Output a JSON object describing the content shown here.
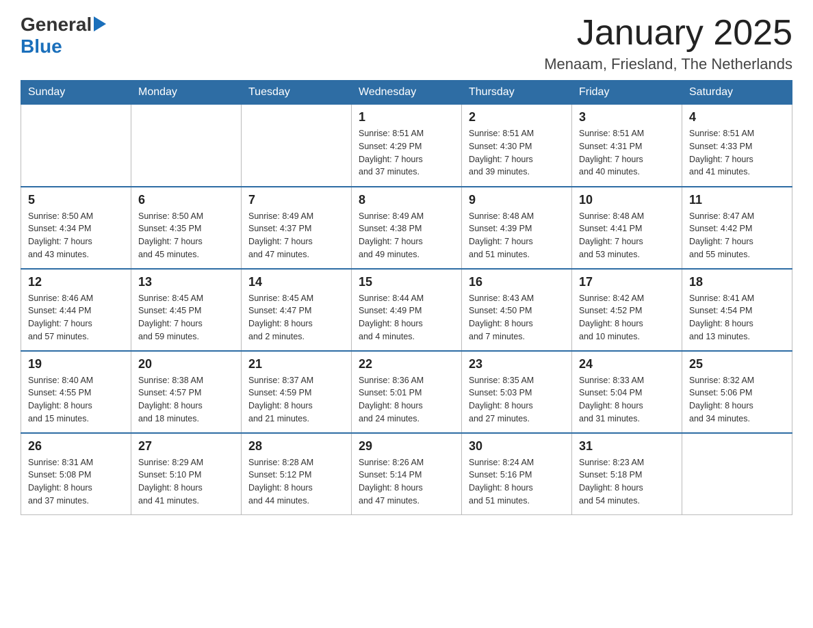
{
  "logo": {
    "text_general": "General",
    "text_blue": "Blue",
    "arrow": "▶"
  },
  "title": "January 2025",
  "subtitle": "Menaam, Friesland, The Netherlands",
  "headers": [
    "Sunday",
    "Monday",
    "Tuesday",
    "Wednesday",
    "Thursday",
    "Friday",
    "Saturday"
  ],
  "weeks": [
    [
      {
        "day": "",
        "info": ""
      },
      {
        "day": "",
        "info": ""
      },
      {
        "day": "",
        "info": ""
      },
      {
        "day": "1",
        "info": "Sunrise: 8:51 AM\nSunset: 4:29 PM\nDaylight: 7 hours\nand 37 minutes."
      },
      {
        "day": "2",
        "info": "Sunrise: 8:51 AM\nSunset: 4:30 PM\nDaylight: 7 hours\nand 39 minutes."
      },
      {
        "day": "3",
        "info": "Sunrise: 8:51 AM\nSunset: 4:31 PM\nDaylight: 7 hours\nand 40 minutes."
      },
      {
        "day": "4",
        "info": "Sunrise: 8:51 AM\nSunset: 4:33 PM\nDaylight: 7 hours\nand 41 minutes."
      }
    ],
    [
      {
        "day": "5",
        "info": "Sunrise: 8:50 AM\nSunset: 4:34 PM\nDaylight: 7 hours\nand 43 minutes."
      },
      {
        "day": "6",
        "info": "Sunrise: 8:50 AM\nSunset: 4:35 PM\nDaylight: 7 hours\nand 45 minutes."
      },
      {
        "day": "7",
        "info": "Sunrise: 8:49 AM\nSunset: 4:37 PM\nDaylight: 7 hours\nand 47 minutes."
      },
      {
        "day": "8",
        "info": "Sunrise: 8:49 AM\nSunset: 4:38 PM\nDaylight: 7 hours\nand 49 minutes."
      },
      {
        "day": "9",
        "info": "Sunrise: 8:48 AM\nSunset: 4:39 PM\nDaylight: 7 hours\nand 51 minutes."
      },
      {
        "day": "10",
        "info": "Sunrise: 8:48 AM\nSunset: 4:41 PM\nDaylight: 7 hours\nand 53 minutes."
      },
      {
        "day": "11",
        "info": "Sunrise: 8:47 AM\nSunset: 4:42 PM\nDaylight: 7 hours\nand 55 minutes."
      }
    ],
    [
      {
        "day": "12",
        "info": "Sunrise: 8:46 AM\nSunset: 4:44 PM\nDaylight: 7 hours\nand 57 minutes."
      },
      {
        "day": "13",
        "info": "Sunrise: 8:45 AM\nSunset: 4:45 PM\nDaylight: 7 hours\nand 59 minutes."
      },
      {
        "day": "14",
        "info": "Sunrise: 8:45 AM\nSunset: 4:47 PM\nDaylight: 8 hours\nand 2 minutes."
      },
      {
        "day": "15",
        "info": "Sunrise: 8:44 AM\nSunset: 4:49 PM\nDaylight: 8 hours\nand 4 minutes."
      },
      {
        "day": "16",
        "info": "Sunrise: 8:43 AM\nSunset: 4:50 PM\nDaylight: 8 hours\nand 7 minutes."
      },
      {
        "day": "17",
        "info": "Sunrise: 8:42 AM\nSunset: 4:52 PM\nDaylight: 8 hours\nand 10 minutes."
      },
      {
        "day": "18",
        "info": "Sunrise: 8:41 AM\nSunset: 4:54 PM\nDaylight: 8 hours\nand 13 minutes."
      }
    ],
    [
      {
        "day": "19",
        "info": "Sunrise: 8:40 AM\nSunset: 4:55 PM\nDaylight: 8 hours\nand 15 minutes."
      },
      {
        "day": "20",
        "info": "Sunrise: 8:38 AM\nSunset: 4:57 PM\nDaylight: 8 hours\nand 18 minutes."
      },
      {
        "day": "21",
        "info": "Sunrise: 8:37 AM\nSunset: 4:59 PM\nDaylight: 8 hours\nand 21 minutes."
      },
      {
        "day": "22",
        "info": "Sunrise: 8:36 AM\nSunset: 5:01 PM\nDaylight: 8 hours\nand 24 minutes."
      },
      {
        "day": "23",
        "info": "Sunrise: 8:35 AM\nSunset: 5:03 PM\nDaylight: 8 hours\nand 27 minutes."
      },
      {
        "day": "24",
        "info": "Sunrise: 8:33 AM\nSunset: 5:04 PM\nDaylight: 8 hours\nand 31 minutes."
      },
      {
        "day": "25",
        "info": "Sunrise: 8:32 AM\nSunset: 5:06 PM\nDaylight: 8 hours\nand 34 minutes."
      }
    ],
    [
      {
        "day": "26",
        "info": "Sunrise: 8:31 AM\nSunset: 5:08 PM\nDaylight: 8 hours\nand 37 minutes."
      },
      {
        "day": "27",
        "info": "Sunrise: 8:29 AM\nSunset: 5:10 PM\nDaylight: 8 hours\nand 41 minutes."
      },
      {
        "day": "28",
        "info": "Sunrise: 8:28 AM\nSunset: 5:12 PM\nDaylight: 8 hours\nand 44 minutes."
      },
      {
        "day": "29",
        "info": "Sunrise: 8:26 AM\nSunset: 5:14 PM\nDaylight: 8 hours\nand 47 minutes."
      },
      {
        "day": "30",
        "info": "Sunrise: 8:24 AM\nSunset: 5:16 PM\nDaylight: 8 hours\nand 51 minutes."
      },
      {
        "day": "31",
        "info": "Sunrise: 8:23 AM\nSunset: 5:18 PM\nDaylight: 8 hours\nand 54 minutes."
      },
      {
        "day": "",
        "info": ""
      }
    ]
  ]
}
